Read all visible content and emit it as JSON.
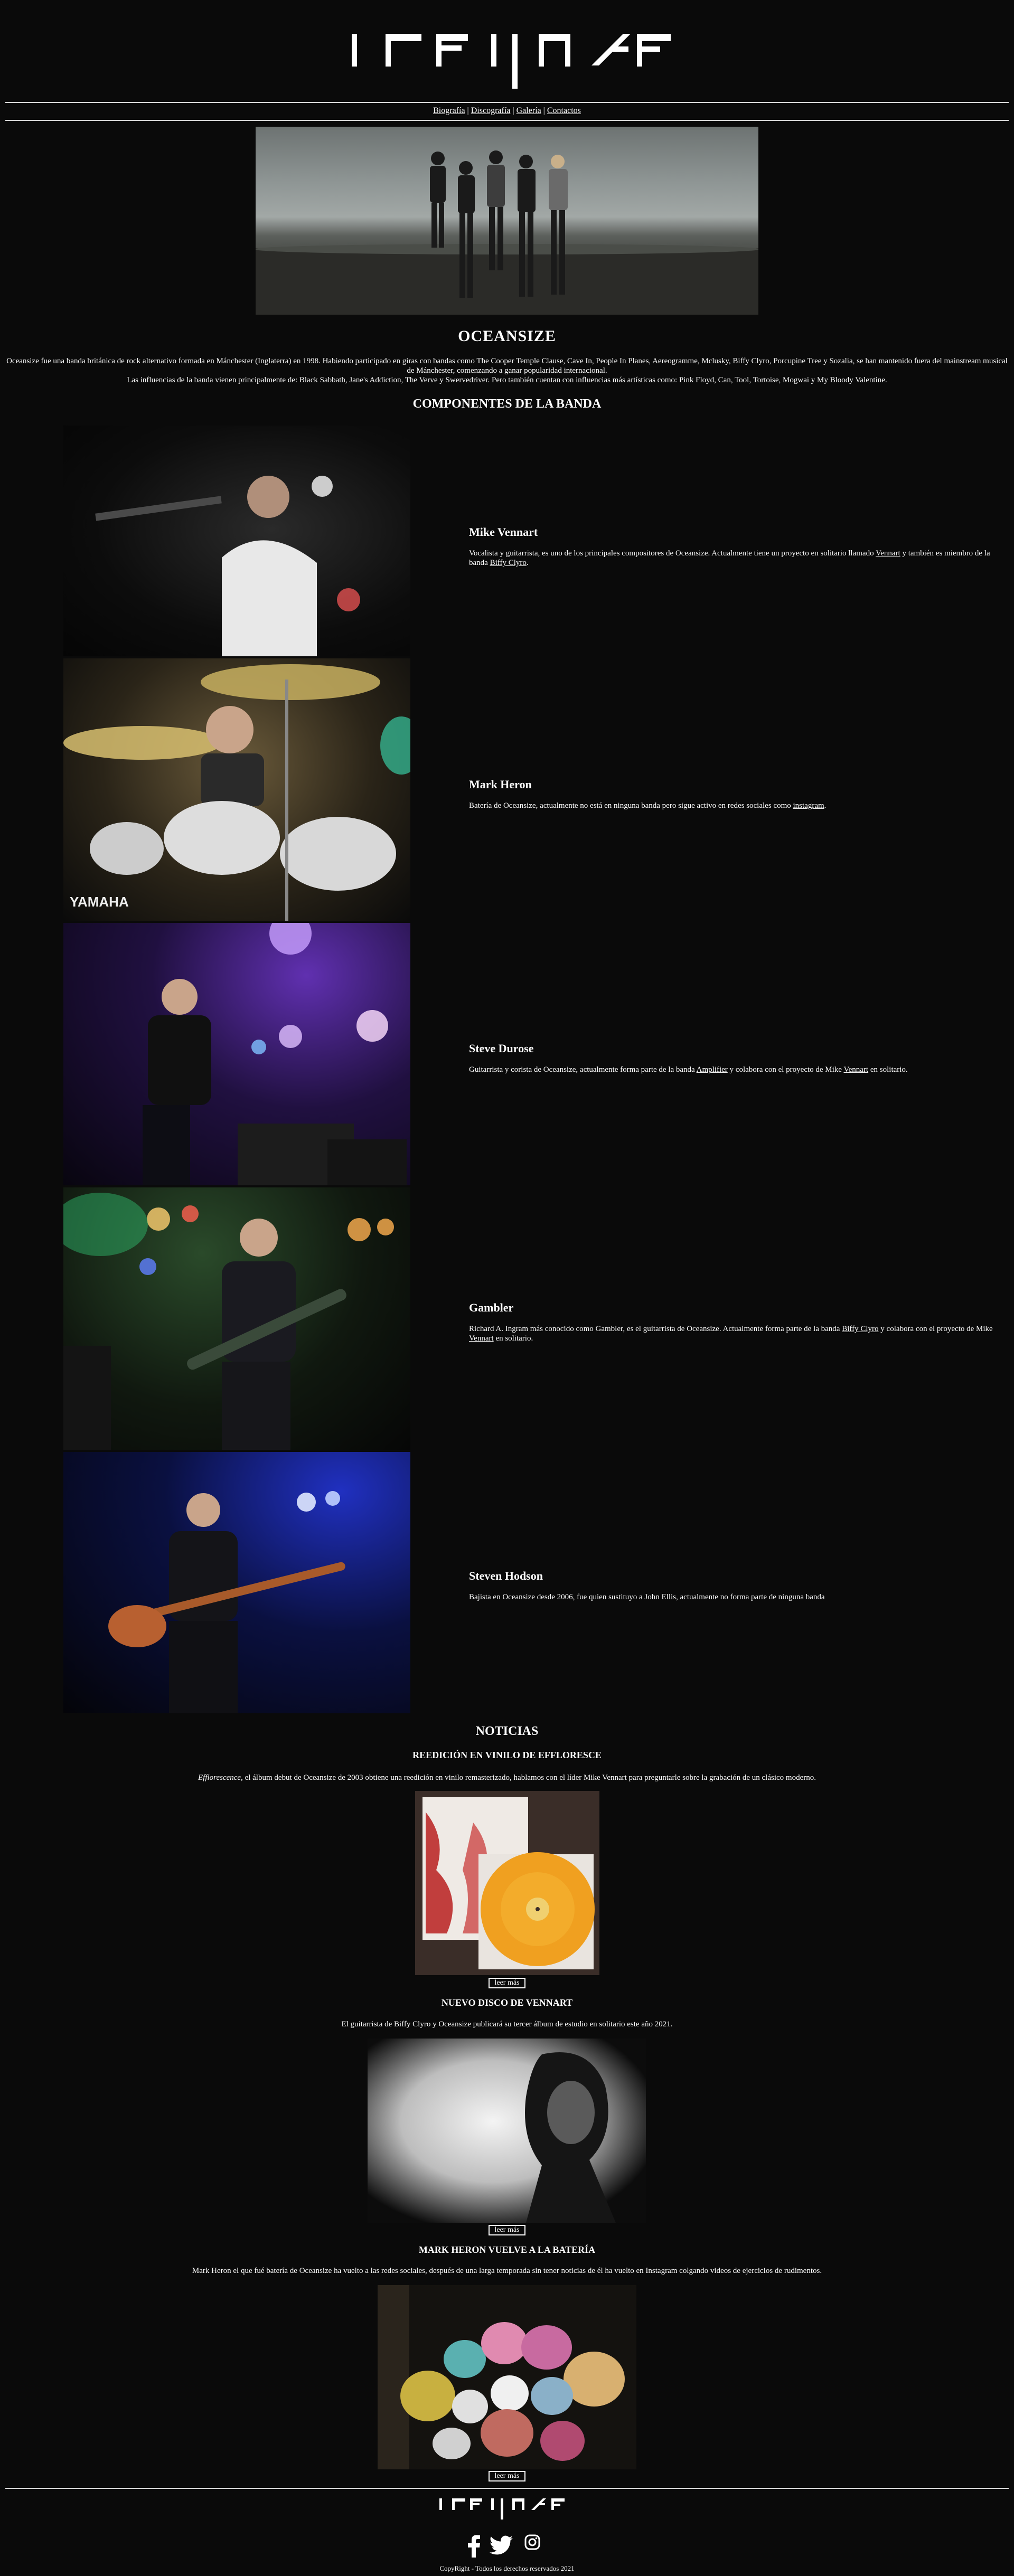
{
  "site": {
    "logo_alt": "OCEANSIZE"
  },
  "nav": {
    "items": [
      "Biografía",
      "Discografía",
      "Galería",
      "Contactos"
    ],
    "separator": "|"
  },
  "band": {
    "title": "OCEANSIZE",
    "intro_line1": "Oceansize fue una banda británica de rock alternativo formada en Mánchester (Inglaterra) en 1998. Habiendo participado en giras con bandas como The Cooper Temple Clause, Cave In, People In Planes, Aereogramme, Mclusky, Biffy Clyro, Porcupine Tree y Sozalia, se han mantenido fuera del mainstream musical de Mánchester, comenzando a ganar popularidad internacional.",
    "intro_line2": "Las influencias de la banda vienen principalmente de: Black Sabbath, Jane's Addiction, The Verve y Swervedriver. Pero también cuentan con influencias más artísticas como: Pink Floyd, Can, Tool, Tortoise, Mogwai y My Bloody Valentine."
  },
  "members": {
    "title": "COMPONENTES DE LA BANDA",
    "list": [
      {
        "name": "Mike Vennart",
        "desc_a": "Vocalista y guitarrista, es uno de los principales compositores de Oceansize. Actualmente tiene un proyecto en solitario llamado ",
        "link_a": "Vennart",
        "desc_b": " y también es miembro de la banda ",
        "link_b": "Biffy Clyro",
        "desc_c": "."
      },
      {
        "name": "Mark Heron",
        "desc_a": "Batería de Oceansize, actualmente no está en ninguna banda pero sigue activo en redes sociales como ",
        "link_a": "instagram",
        "desc_b": "."
      },
      {
        "name": "Steve Durose",
        "desc_a": "Guitarrista y corista de Oceansize, actualmente forma parte de la banda ",
        "link_a": "Amplifier",
        "desc_b": " y colabora con el proyecto de Mike ",
        "link_b": "Vennart",
        "desc_c": " en solitario."
      },
      {
        "name": "Gambler",
        "desc_a": "Richard A. Ingram más conocido como Gambler, es el guitarrista de Oceansize. Actualmente forma parte de la banda ",
        "link_a": "Biffy Clyro",
        "desc_b": " y colabora con el proyecto de Mike ",
        "link_b": "Vennart",
        "desc_c": " en solitario."
      },
      {
        "name": "Steven Hodson",
        "desc_a": "Bajista en Oceansize desde 2006, fue quien sustituyo a John Ellis, actualmente no forma parte de ninguna banda"
      }
    ]
  },
  "news": {
    "title": "NOTICIAS",
    "read_more": "leer más",
    "items": [
      {
        "title": "REEDICIÓN EN VINILO DE EFFLORESCE",
        "text_em": "Efflorescence",
        "text": ", el álbum debut de Oceansize de 2003 obtiene una reedición en vinilo remasterizado, hablamos con el líder Mike Vennart para preguntarle sobre la grabación de un clásico moderno."
      },
      {
        "title": "NUEVO DISCO DE VENNART",
        "text": "El guitarrista de Biffy Clyro y Oceansize publicará su tercer álbum de estudio en solitario este año 2021."
      },
      {
        "title": "MARK HERON VUELVE A LA BATERÍA",
        "text": "Mark Heron el que fué batería de Oceansize ha vuelto a las redes sociales, después de una larga temporada sin tener noticias de él ha vuelto en Instagram colgando videos de ejercicios de rudimentos."
      }
    ]
  },
  "footer": {
    "copyright": "CopyRight - Todos los derechos reservados 2021"
  },
  "icons": [
    "facebook-icon",
    "twitter-icon",
    "instagram-icon"
  ],
  "colors": {
    "background": "#0a0a0a",
    "text": "#ffffff",
    "rule": "#d8d8d8"
  }
}
